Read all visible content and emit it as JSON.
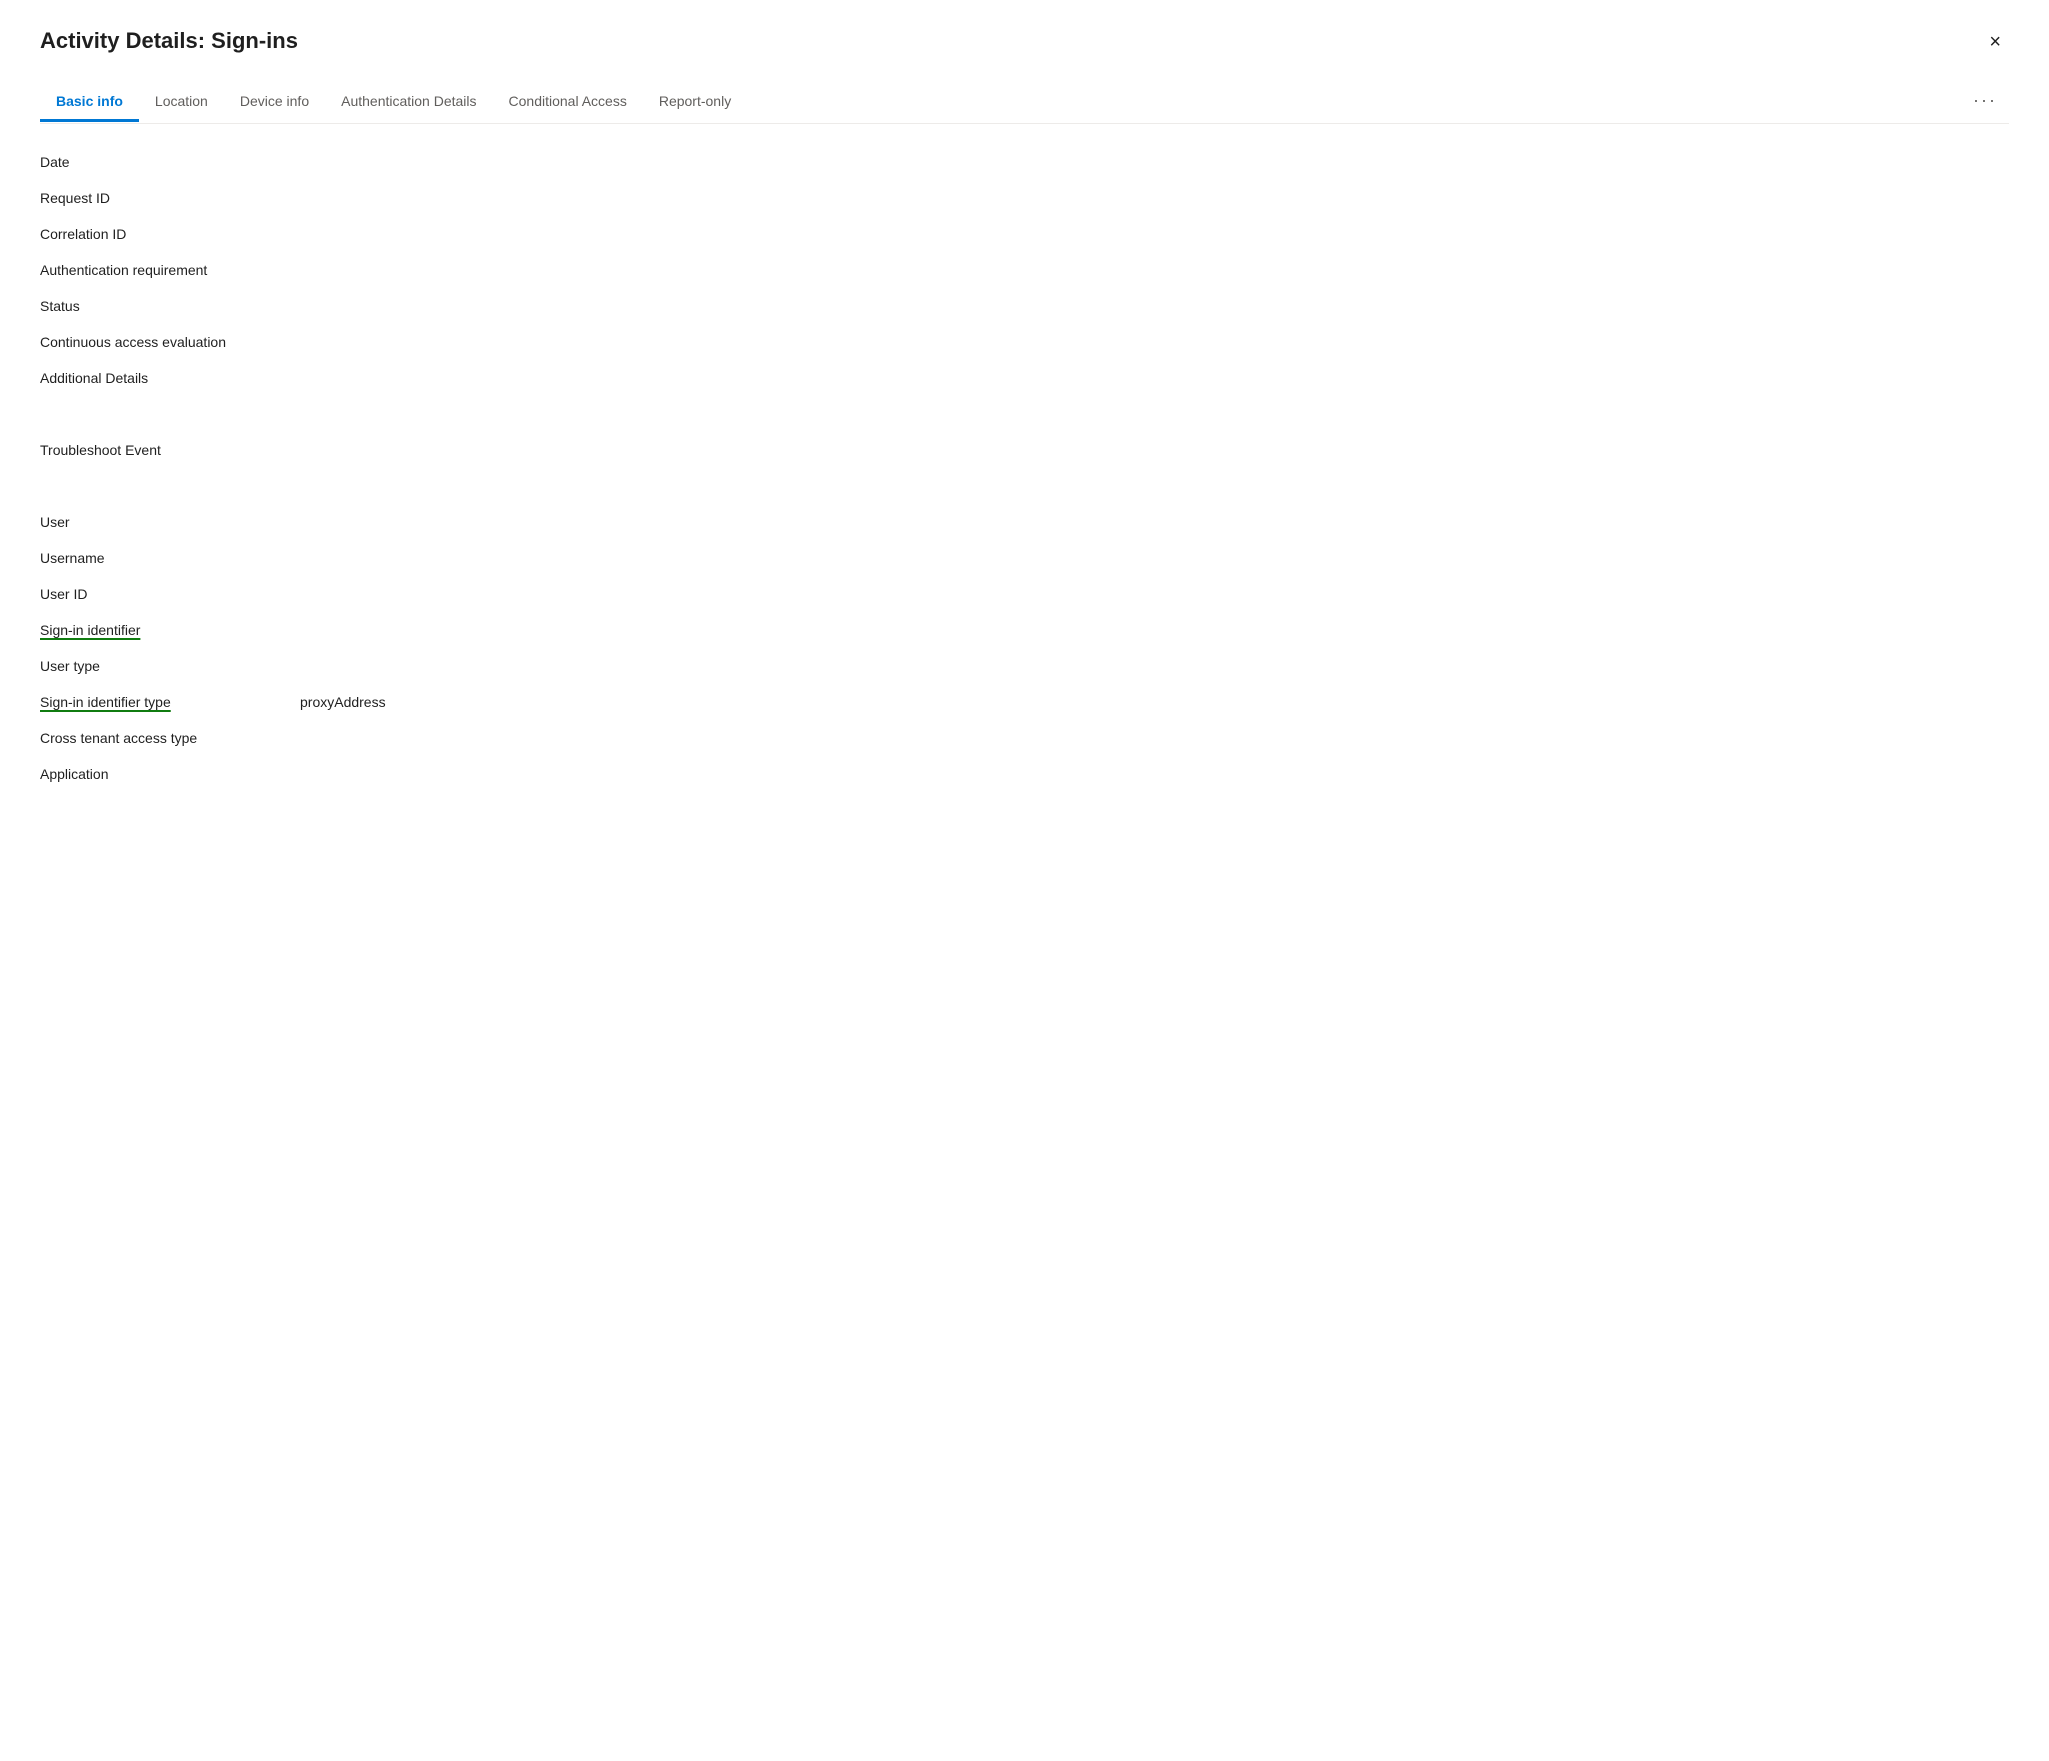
{
  "dialog": {
    "title": "Activity Details: Sign-ins",
    "close_label": "×"
  },
  "tabs": [
    {
      "id": "basic-info",
      "label": "Basic info",
      "active": true
    },
    {
      "id": "location",
      "label": "Location",
      "active": false
    },
    {
      "id": "device-info",
      "label": "Device info",
      "active": false
    },
    {
      "id": "authentication-details",
      "label": "Authentication Details",
      "active": false
    },
    {
      "id": "conditional-access",
      "label": "Conditional Access",
      "active": false
    },
    {
      "id": "report-only",
      "label": "Report-only",
      "active": false
    }
  ],
  "more_label": "···",
  "fields_group1": [
    {
      "id": "date",
      "label": "Date",
      "value": "",
      "underlined": false
    },
    {
      "id": "request-id",
      "label": "Request ID",
      "value": "",
      "underlined": false
    },
    {
      "id": "correlation-id",
      "label": "Correlation ID",
      "value": "",
      "underlined": false
    },
    {
      "id": "authentication-requirement",
      "label": "Authentication requirement",
      "value": "",
      "underlined": false
    },
    {
      "id": "status",
      "label": "Status",
      "value": "",
      "underlined": false
    },
    {
      "id": "continuous-access-evaluation",
      "label": "Continuous access evaluation",
      "value": "",
      "underlined": false
    },
    {
      "id": "additional-details",
      "label": "Additional Details",
      "value": "",
      "underlined": false
    }
  ],
  "fields_group2": [
    {
      "id": "troubleshoot-event",
      "label": "Troubleshoot Event",
      "value": "",
      "underlined": false
    }
  ],
  "fields_group3": [
    {
      "id": "user",
      "label": "User",
      "value": "",
      "underlined": false
    },
    {
      "id": "username",
      "label": "Username",
      "value": "",
      "underlined": false
    },
    {
      "id": "user-id",
      "label": "User ID",
      "value": "",
      "underlined": false
    },
    {
      "id": "sign-in-identifier",
      "label": "Sign-in identifier",
      "value": "",
      "underlined": true
    },
    {
      "id": "user-type",
      "label": "User type",
      "value": "",
      "underlined": false
    },
    {
      "id": "sign-in-identifier-type",
      "label": "Sign-in identifier type",
      "value": "proxyAddress",
      "underlined": true
    },
    {
      "id": "cross-tenant-access-type",
      "label": "Cross tenant access type",
      "value": "",
      "underlined": false
    },
    {
      "id": "application",
      "label": "Application",
      "value": "",
      "underlined": false
    }
  ]
}
